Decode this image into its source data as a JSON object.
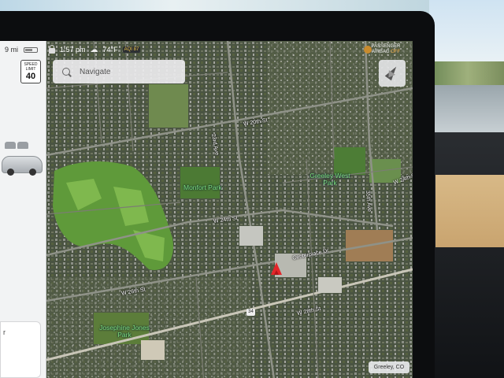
{
  "status_bar": {
    "range": "9 mi",
    "time": "1:57 pm",
    "temperature": "74°F",
    "aqi": "AQI 87"
  },
  "speed_limit": {
    "label": "SPEED LIMIT",
    "value": "40"
  },
  "media_card": {
    "partial_text": "r"
  },
  "navigate": {
    "placeholder": "Navigate"
  },
  "airbag": {
    "line1": "PASSENGER",
    "line2": "AIRBAG",
    "state": "OFF"
  },
  "map": {
    "streets": [
      "W 20th St",
      "W 24th St",
      "W 26th St",
      "W 28th St",
      "W 24th St",
      "Centerplace Dr",
      "23rd Ave",
      "35th Ave"
    ],
    "parks": [
      "Monfort Park",
      "Greeley West Park",
      "Josephine Jones Park"
    ],
    "highway_shield": "34",
    "location": "Greeley, CO"
  },
  "colors": {
    "park_label": "#7ee07a",
    "nav_arrow": "#e3262a",
    "map_base": "#3f4a38"
  }
}
